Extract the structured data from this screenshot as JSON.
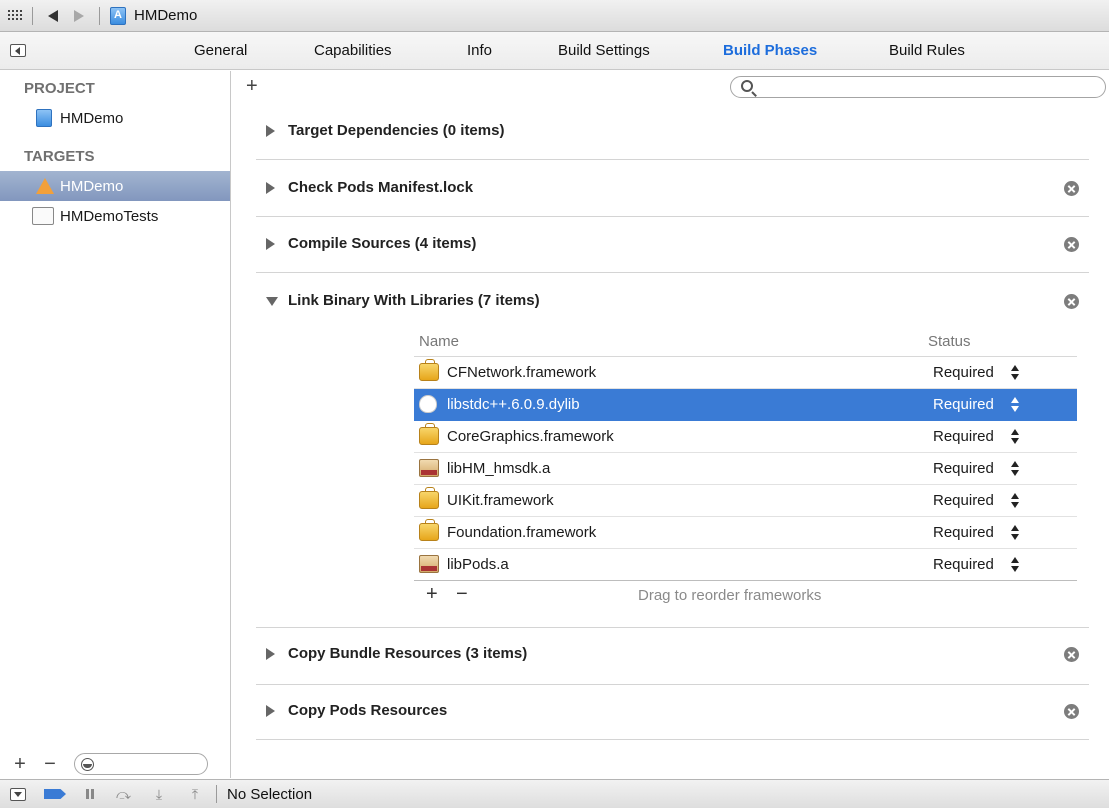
{
  "jumpbar": {
    "title": "HMDemo"
  },
  "tabs": [
    {
      "label": "General",
      "active": false
    },
    {
      "label": "Capabilities",
      "active": false
    },
    {
      "label": "Info",
      "active": false
    },
    {
      "label": "Build Settings",
      "active": false
    },
    {
      "label": "Build Phases",
      "active": true
    },
    {
      "label": "Build Rules",
      "active": false
    }
  ],
  "sidebar": {
    "project_header": "PROJECT",
    "project_item": "HMDemo",
    "targets_header": "TARGETS",
    "targets": [
      {
        "label": "HMDemo",
        "selected": true
      },
      {
        "label": "HMDemoTests",
        "selected": false
      }
    ]
  },
  "main": {
    "search_placeholder": "",
    "phases": [
      {
        "title": "Target Dependencies (0 items)",
        "expanded": false,
        "deletable": false
      },
      {
        "title": "Check Pods Manifest.lock",
        "expanded": false,
        "deletable": true
      },
      {
        "title": "Compile Sources (4 items)",
        "expanded": false,
        "deletable": true
      },
      {
        "title": "Link Binary With Libraries (7 items)",
        "expanded": true,
        "deletable": true
      },
      {
        "title": "Copy Bundle Resources (3 items)",
        "expanded": false,
        "deletable": true
      },
      {
        "title": "Copy Pods Resources",
        "expanded": false,
        "deletable": true
      }
    ],
    "libraries": {
      "columns": [
        "Name",
        "Status"
      ],
      "rows": [
        {
          "name": "CFNetwork.framework",
          "status": "Required",
          "icon": "framework-icon",
          "selected": false
        },
        {
          "name": "libstdc++.6.0.9.dylib",
          "status": "Required",
          "icon": "dylib-icon",
          "selected": true
        },
        {
          "name": "CoreGraphics.framework",
          "status": "Required",
          "icon": "framework-icon",
          "selected": false
        },
        {
          "name": "libHM_hmsdk.a",
          "status": "Required",
          "icon": "archive-icon",
          "selected": false
        },
        {
          "name": "UIKit.framework",
          "status": "Required",
          "icon": "framework-icon",
          "selected": false
        },
        {
          "name": "Foundation.framework",
          "status": "Required",
          "icon": "framework-icon",
          "selected": false
        },
        {
          "name": "libPods.a",
          "status": "Required",
          "icon": "archive-icon",
          "selected": false
        }
      ],
      "add_label": "+",
      "remove_label": "−",
      "hint": "Drag to reorder frameworks"
    }
  },
  "debugbar": {
    "status": "No Selection"
  },
  "colors": {
    "accent": "#1d6ddc",
    "selection": "#3a7bd5",
    "sidebar_selection": "#8ea2c6"
  }
}
